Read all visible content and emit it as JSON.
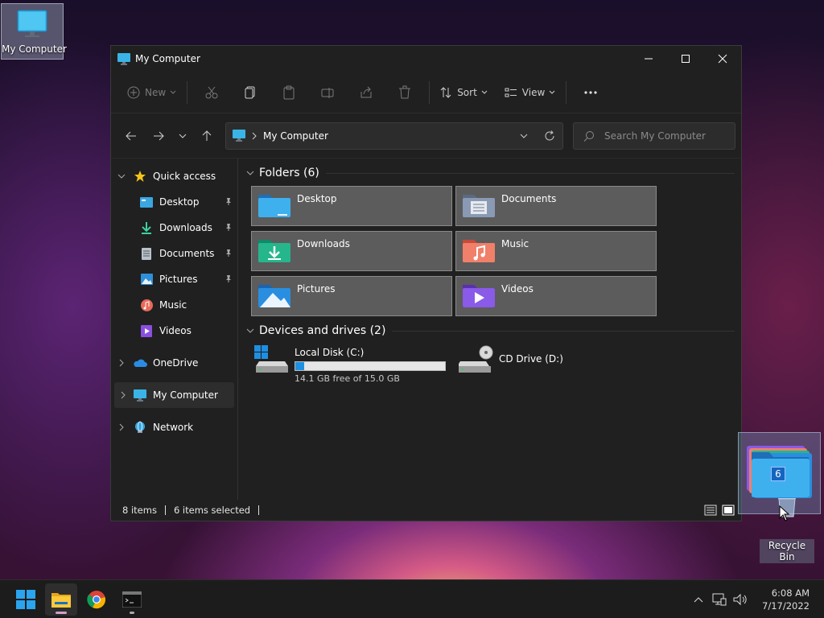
{
  "desktop": {
    "my_computer_label": "My Computer",
    "recycle_bin_label": "Recycle Bin",
    "drag_count": "6"
  },
  "window": {
    "title": "My Computer",
    "toolbar": {
      "new_label": "New",
      "sort_label": "Sort",
      "view_label": "View"
    },
    "address": {
      "crumb": "My Computer"
    },
    "search": {
      "placeholder": "Search My Computer"
    },
    "sidebar": {
      "quick_access": "Quick access",
      "items": [
        {
          "label": "Desktop",
          "pinned": true
        },
        {
          "label": "Downloads",
          "pinned": true
        },
        {
          "label": "Documents",
          "pinned": true
        },
        {
          "label": "Pictures",
          "pinned": true
        },
        {
          "label": "Music",
          "pinned": false
        },
        {
          "label": "Videos",
          "pinned": false
        }
      ],
      "onedrive": "OneDrive",
      "my_computer": "My Computer",
      "network": "Network"
    },
    "folders_group": "Folders (6)",
    "folders": [
      {
        "label": "Desktop"
      },
      {
        "label": "Documents"
      },
      {
        "label": "Downloads"
      },
      {
        "label": "Music"
      },
      {
        "label": "Pictures"
      },
      {
        "label": "Videos"
      }
    ],
    "drives_group": "Devices and drives (2)",
    "drives": [
      {
        "label": "Local Disk (C:)",
        "free_text": "14.1 GB free of 15.0 GB",
        "used_fraction": 0.06
      },
      {
        "label": "CD Drive (D:)"
      }
    ],
    "status": {
      "items": "8 items",
      "selected": "6 items selected"
    }
  },
  "taskbar": {
    "time": "6:08 AM",
    "date": "7/17/2022"
  }
}
